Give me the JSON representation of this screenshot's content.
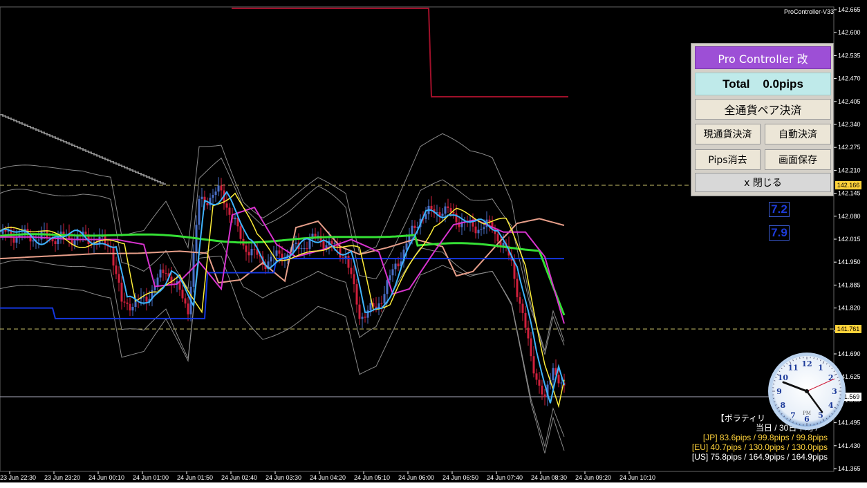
{
  "app": {
    "indicator_name": "ProController-V33"
  },
  "price_axis": {
    "ticks": [
      "142.665",
      "142.600",
      "142.535",
      "142.470",
      "142.405",
      "142.340",
      "142.275",
      "142.210",
      "142.145",
      "142.080",
      "142.015",
      "141.950",
      "141.885",
      "141.820",
      "141.755",
      "141.690",
      "141.625",
      "141.560",
      "141.495",
      "141.430",
      "141.365"
    ],
    "flags": {
      "upper": "142.166",
      "lower": "141.761",
      "current": "141.569"
    }
  },
  "time_axis": {
    "ticks": [
      "23 Jun 22:30",
      "23 Jun 23:20",
      "24 Jun 00:10",
      "24 Jun 01:00",
      "24 Jun 01:50",
      "24 Jun 02:40",
      "24 Jun 03:30",
      "24 Jun 04:20",
      "24 Jun 05:10",
      "24 Jun 06:00",
      "24 Jun 06:50",
      "24 Jun 07:40",
      "24 Jun 08:30",
      "24 Jun 09:20",
      "24 Jun 10:10"
    ]
  },
  "controller": {
    "title": "Pro Controller 改",
    "total": "Total    0.0pips",
    "close_all_pairs": "全通貨ペア決済",
    "close_current": "現通貨決済",
    "auto_close": "自動決済",
    "clear_pips": "Pips消去",
    "save_screen": "画面保存",
    "close": "x 閉じる"
  },
  "volatility": {
    "value_1": "7.2",
    "value_2": "7.9",
    "heading": "【ボラティリ",
    "subheading": "当日 / 30日平均 /",
    "jp": "[JP] 83.6pips / 99.8pips / 99.8pips",
    "eu": "[EU] 40.7pips / 130.0pips / 130.0pips",
    "us": "[US] 75.8pips / 164.9pips / 164.9pips"
  },
  "clock": {
    "label": "PM",
    "hours": [
      1,
      2,
      3,
      4,
      5,
      6,
      7,
      8,
      9,
      10,
      11,
      12
    ]
  },
  "colors": {
    "bull_candle": "#4a6fc7",
    "bear_candle": "#d0203c",
    "sma_yellow": "#ffef3a",
    "sma_cyan": "#3fb4ff",
    "sma_magenta": "#d933cf",
    "sma_green": "#35e035",
    "sma_salmon": "#e89f8a",
    "sma_blue": "#1437e0",
    "bollinger": "#8a8a8a",
    "level_line": "#c9c06a",
    "title_bar": "#9d4fd6"
  }
}
